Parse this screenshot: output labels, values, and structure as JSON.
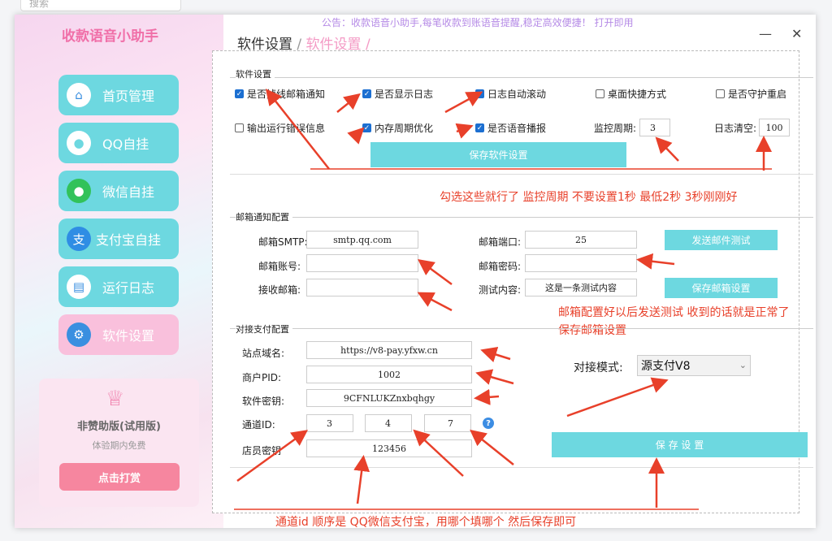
{
  "background": {
    "search_placeholder": "搜索"
  },
  "notice": "公告：收款语音小助手,每笔收款到账语音提醒,稳定高效便捷！ 打开即用",
  "app_title": "收款语音小助手",
  "sidebar": {
    "items": [
      {
        "label": "首页管理",
        "icon": "home-icon"
      },
      {
        "label": "QQ自挂",
        "icon": "qq-icon"
      },
      {
        "label": "微信自挂",
        "icon": "wechat-icon"
      },
      {
        "label": "支付宝自挂",
        "icon": "alipay-icon"
      },
      {
        "label": "运行日志",
        "icon": "clipboard-icon"
      },
      {
        "label": "软件设置",
        "icon": "gear-icon"
      }
    ],
    "card": {
      "version": "非赞助版(试用版)",
      "trial": "体验期内免费",
      "reward_button": "点击打赏"
    }
  },
  "breadcrumb": {
    "root": "软件设置",
    "sep": "/",
    "current": "软件设置",
    "sep2": "/"
  },
  "software": {
    "title": "软件设置",
    "checkboxes": [
      {
        "label": "是否掉线邮箱通知",
        "checked": true
      },
      {
        "label": "是否显示日志",
        "checked": true
      },
      {
        "label": "日志自动滚动",
        "checked": true
      },
      {
        "label": "桌面快捷方式",
        "checked": false
      },
      {
        "label": "是否守护重启",
        "checked": false
      },
      {
        "label": "输出运行错误信息",
        "checked": false
      },
      {
        "label": "内存周期优化",
        "checked": true
      },
      {
        "label": "是否语音播报",
        "checked": true
      }
    ],
    "monitor_label": "监控周期:",
    "monitor_value": "3",
    "log_clear_label": "日志清空:",
    "log_clear_value": "100",
    "save_button": "保存软件设置"
  },
  "note1": "勾选这些就行了  监控周期 不要设置1秒 最低2秒   3秒刚刚好",
  "mail": {
    "title": "邮箱通知配置",
    "smtp_label": "邮箱SMTP:",
    "smtp_value": "smtp.qq.com",
    "port_label": "邮箱端口:",
    "port_value": "25",
    "test_button": "发送邮件测试",
    "account_label": "邮箱账号:",
    "account_value": "",
    "password_label": "邮箱密码:",
    "password_value": "",
    "receive_label": "接收邮箱:",
    "receive_value": "",
    "content_label": "测试内容:",
    "content_value": "这是一条测试内容",
    "save_button": "保存邮箱设置"
  },
  "note2_line1": "邮箱配置好以后发送测试 收到的话就是正常了",
  "note2_line2": "保存邮箱设置",
  "pay": {
    "title": "对接支付配置",
    "domain_label": "站点域名:",
    "domain_value": "https://v8-pay.yfxw.cn",
    "pid_label": "商户PID:",
    "pid_value": "1002",
    "key_label": "软件密钥:",
    "key_value": "9CFNLUKZnxbqhgy",
    "channel_label": "通道ID:",
    "channel_values": [
      "3",
      "4",
      "7"
    ],
    "clerk_label": "店员密钥",
    "clerk_value": "123456",
    "mode_label": "对接模式:",
    "mode_value": "源支付V8",
    "save_button": "保 存 设 置"
  },
  "note3": "通道id 顺序是 QQ微信支付宝，用哪个填哪个 然后保存即可",
  "colors": {
    "accent": "#6dd8e0",
    "pink": "#f06fa8",
    "annotation": "#e8402a"
  }
}
